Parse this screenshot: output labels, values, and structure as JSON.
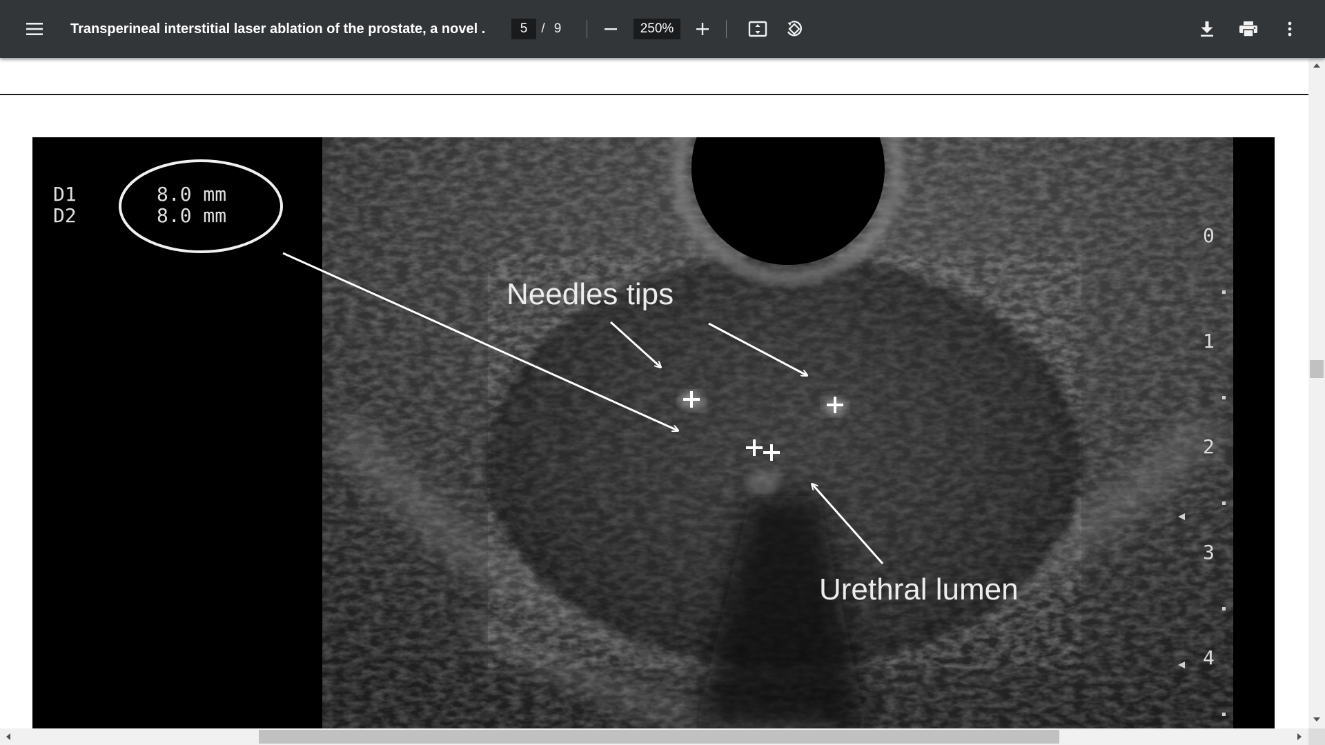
{
  "toolbar": {
    "menu_icon": "hamburger-menu-icon",
    "title": "Transperineal interstitial laser ablation of the prostate, a novel ...",
    "page_current": "5",
    "page_separator": "/",
    "page_total": "9",
    "zoom": "250%",
    "icons": {
      "zoom_out": "minus-icon",
      "zoom_in": "plus-icon",
      "fit": "fit-to-page-icon",
      "rotate": "rotate-counterclockwise-icon",
      "download": "download-icon",
      "print": "printer-icon",
      "more": "more-vertical-icon"
    }
  },
  "figure": {
    "measure_labels": [
      "D1",
      "D2"
    ],
    "measure_values": [
      "8.0 mm",
      "8.0 mm"
    ],
    "annotation_needles": "Needles tips",
    "annotation_urethra": "Urethral lumen",
    "depth_scale": [
      "0",
      "1",
      "2",
      "3",
      "4"
    ]
  },
  "colors": {
    "toolbar_bg": "#323639",
    "input_bg": "#191b1c",
    "page_bg": "#ffffff",
    "scrollbar_track": "#f1f1f1",
    "scrollbar_thumb": "#c1c1c1"
  }
}
